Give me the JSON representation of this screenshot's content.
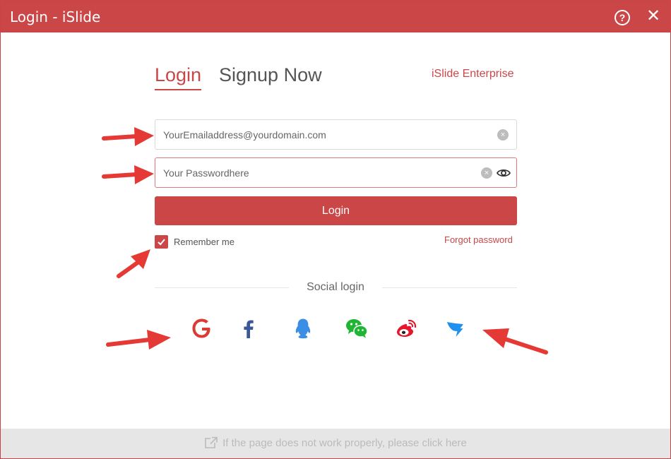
{
  "window": {
    "title": "Login - iSlide",
    "help_glyph": "?",
    "close_glyph": "✕"
  },
  "tabs": {
    "login": "Login",
    "signup": "Signup Now",
    "enterprise": "iSlide Enterprise"
  },
  "form": {
    "email_placeholder": "YourEmailaddress@yourdomain.com",
    "password_placeholder": "Your Passwordhere",
    "login_button": "Login",
    "remember_me": "Remember me",
    "remember_checked": true,
    "forgot_password": "Forgot password"
  },
  "social": {
    "label": "Social login",
    "providers": [
      "google-icon",
      "facebook-icon",
      "qq-icon",
      "wechat-icon",
      "weibo-icon",
      "dingtalk-icon"
    ]
  },
  "footer": {
    "text": "If the page does not work properly, please click here"
  },
  "colors": {
    "accent": "#cb4647",
    "annotation_arrow": "#e53935"
  }
}
